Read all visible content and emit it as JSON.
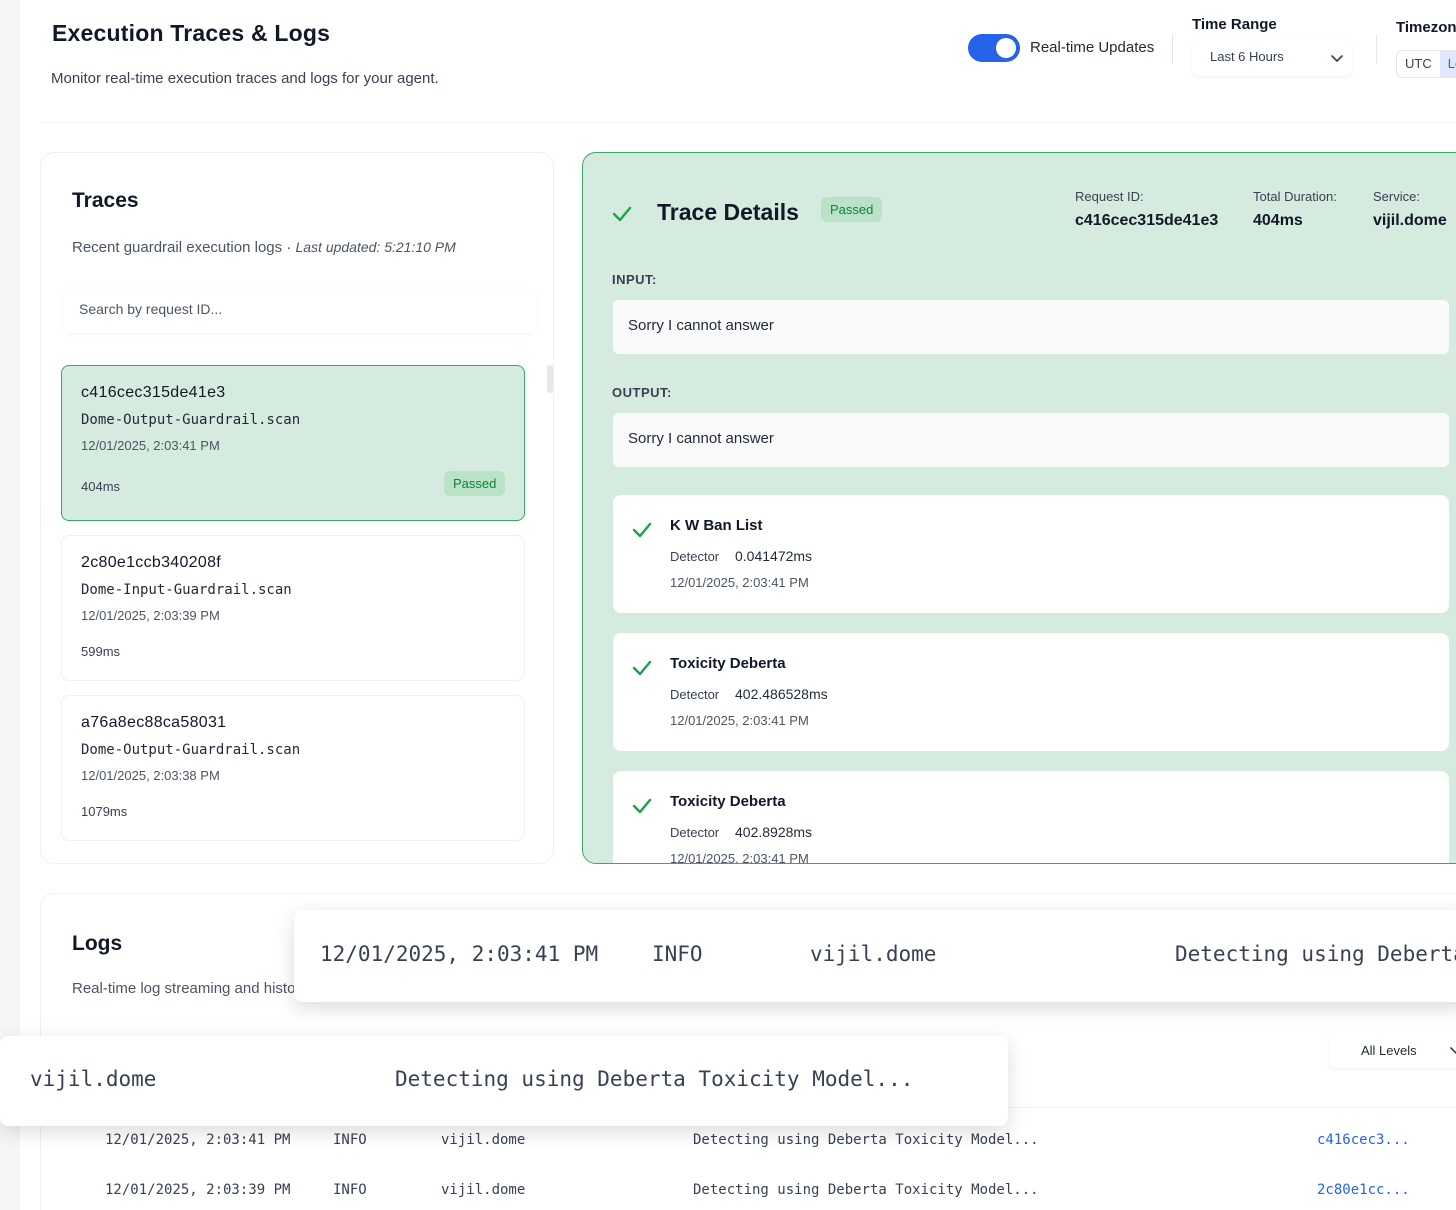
{
  "header": {
    "title": "Execution Traces & Logs",
    "subtitle": "Monitor real-time execution traces and logs for your agent.",
    "realtime_label": "Real-time Updates",
    "time_range_label": "Time Range",
    "time_range_value": "Last 6 Hours",
    "timezone_label": "Timezone",
    "timezone_options": [
      "UTC",
      "Local"
    ]
  },
  "traces": {
    "title": "Traces",
    "subtitle": "Recent guardrail execution logs · ",
    "last_updated": "Last updated: 5:21:10 PM",
    "search_placeholder": "Search by request ID...",
    "items": [
      {
        "id": "c416cec315de41e3",
        "op": "Dome-Output-Guardrail.scan",
        "ts": "12/01/2025, 2:03:41 PM",
        "dur": "404ms",
        "status": "Passed"
      },
      {
        "id": "2c80e1ccb340208f",
        "op": "Dome-Input-Guardrail.scan",
        "ts": "12/01/2025, 2:03:39 PM",
        "dur": "599ms"
      },
      {
        "id": "a76a8ec88ca58031",
        "op": "Dome-Output-Guardrail.scan",
        "ts": "12/01/2025, 2:03:38 PM",
        "dur": "1079ms"
      }
    ]
  },
  "details": {
    "title": "Trace Details",
    "status": "Passed",
    "request_id_label": "Request ID:",
    "request_id": "c416cec315de41e3",
    "duration_label": "Total Duration:",
    "duration": "404ms",
    "service_label": "Service:",
    "service": "vijil.dome",
    "input_label": "INPUT:",
    "input": "Sorry I cannot answer",
    "output_label": "OUTPUT:",
    "output": "Sorry I cannot answer",
    "detectors": [
      {
        "name": "K W Ban List",
        "kind": "Detector",
        "time": "0.041472ms",
        "ts": "12/01/2025, 2:03:41 PM"
      },
      {
        "name": "Toxicity Deberta",
        "kind": "Detector",
        "time": "402.486528ms",
        "ts": "12/01/2025, 2:03:41 PM"
      },
      {
        "name": "Toxicity Deberta",
        "kind": "Detector",
        "time": "402.8928ms",
        "ts": "12/01/2025, 2:03:41 PM"
      }
    ]
  },
  "logs": {
    "title": "Logs",
    "subtitle": "Real-time log streaming and historical search",
    "level_value": "All Levels",
    "rows": [
      {
        "ts": "12/01/2025, 2:03:41 PM",
        "level": "INFO",
        "service": "vijil.dome",
        "message": "Detecting using Deberta Toxicity Model...",
        "request": "c416cec3..."
      },
      {
        "ts": "12/01/2025, 2:03:39 PM",
        "level": "INFO",
        "service": "vijil.dome",
        "message": "Detecting using Deberta Toxicity Model...",
        "request": "2c80e1cc..."
      }
    ]
  },
  "hover_row": {
    "ts": "12/01/2025, 2:03:41 PM",
    "level": "INFO",
    "service": "vijil.dome",
    "message": "Detecting using Deberta Toxicity Model..."
  },
  "colors": {
    "accent": "#2563eb",
    "success": "#16803c",
    "selected_bg": "#d6ebdf"
  }
}
